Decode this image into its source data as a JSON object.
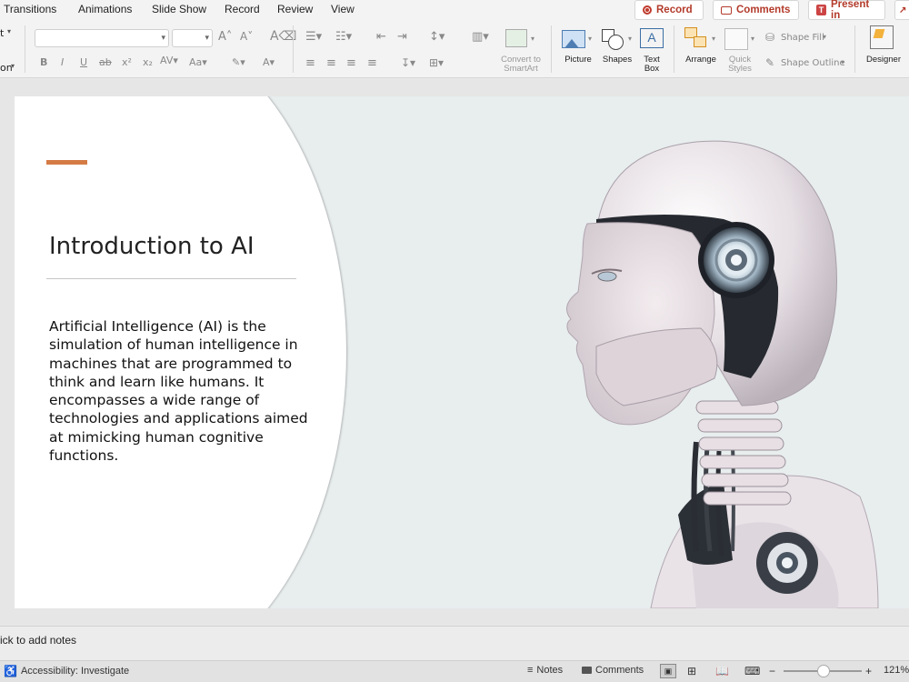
{
  "menu": [
    "Transitions",
    "Animations",
    "Slide Show",
    "Record",
    "Review",
    "View"
  ],
  "top_buttons": {
    "record": "Record",
    "comments": "Comments",
    "present": "Present in"
  },
  "ribbon": {
    "left_clipped_1": "t",
    "left_clipped_2": "on",
    "font_name": "",
    "font_size": "",
    "convert_smartart": "Convert to SmartArt",
    "picture": "Picture",
    "shapes": "Shapes",
    "text_box": "Text Box",
    "arrange": "Arrange",
    "quick_styles": "Quick Styles",
    "shape_fill": "Shape Fill",
    "shape_outline": "Shape Outline",
    "designer": "Designer"
  },
  "slide": {
    "title": "Introduction to AI",
    "body": "Artificial Intelligence (AI) is the simulation of human intelligence in machines that are programmed to think and learn like humans. It encompasses a wide range of technologies and applications aimed at mimicking human cognitive functions.",
    "accent_color": "#d47b45"
  },
  "notes": {
    "placeholder": "ick to add notes"
  },
  "status": {
    "accessibility": "Accessibility: Investigate",
    "notes": "Notes",
    "comments": "Comments",
    "zoom": "121%"
  }
}
